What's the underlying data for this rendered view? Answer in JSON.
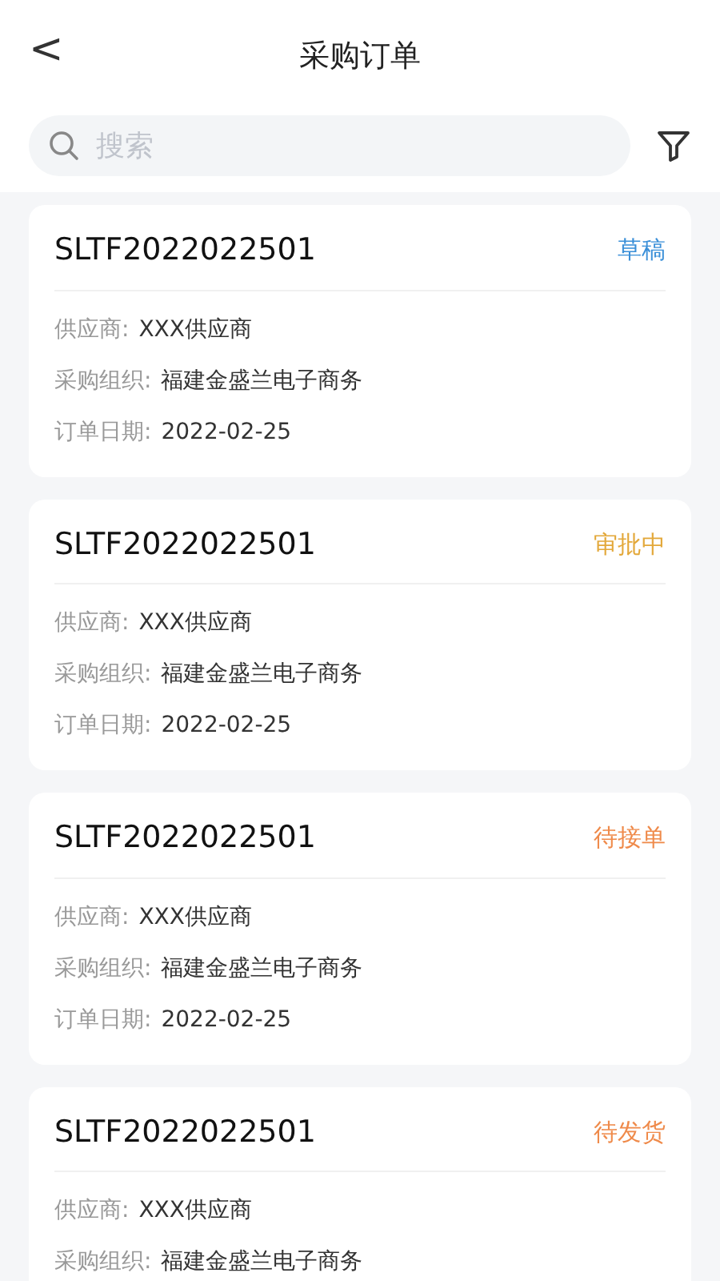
{
  "header": {
    "back": "<",
    "title": "采购订单"
  },
  "search": {
    "placeholder": "搜索"
  },
  "orders": [
    {
      "number": "SLTF2022022501",
      "status": "草稿",
      "color": "#3a8fd8",
      "fields": [
        {
          "label": "供应商:",
          "value": "XXX供应商"
        },
        {
          "label": "采购组织:",
          "value": "福建金盛兰电子商务"
        },
        {
          "label": "订单日期:",
          "value": "2022-02-25"
        }
      ]
    },
    {
      "number": "SLTF2022022501",
      "status": "审批中",
      "color": "#e3a83a",
      "fields": [
        {
          "label": "供应商:",
          "value": "XXX供应商"
        },
        {
          "label": "采购组织:",
          "value": "福建金盛兰电子商务"
        },
        {
          "label": "订单日期:",
          "value": "2022-02-25"
        }
      ]
    },
    {
      "number": "SLTF2022022501",
      "status": "待接单",
      "color": "#ef8a4a",
      "fields": [
        {
          "label": "供应商:",
          "value": "XXX供应商"
        },
        {
          "label": "采购组织:",
          "value": "福建金盛兰电子商务"
        },
        {
          "label": "订单日期:",
          "value": "2022-02-25"
        }
      ]
    },
    {
      "number": "SLTF2022022501",
      "status": "待发货",
      "color": "#ef8a4a",
      "fields": [
        {
          "label": "供应商:",
          "value": "XXX供应商"
        },
        {
          "label": "采购组织:",
          "value": "福建金盛兰电子商务"
        }
      ]
    }
  ]
}
